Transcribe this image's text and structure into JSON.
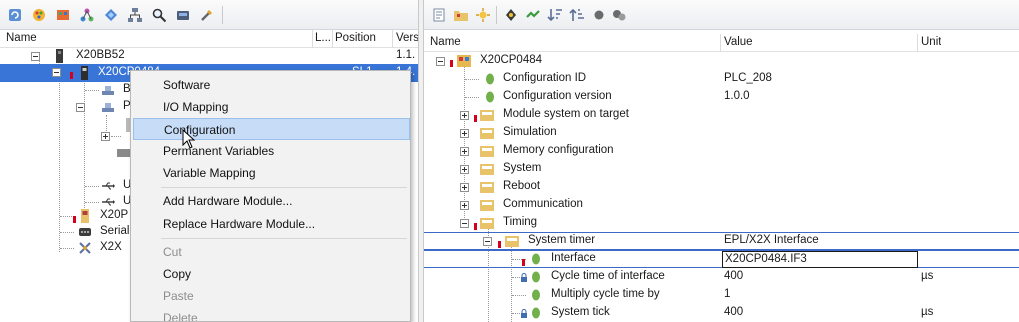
{
  "left_pane": {
    "toolbar_icons": [
      "refresh-icon",
      "palette-icon",
      "module-icon",
      "network-icon",
      "diamond-icon",
      "hierarchy-icon",
      "find-icon",
      "device-icon",
      "tools-icon"
    ],
    "columns": {
      "name": "Name",
      "l": "L...",
      "position": "Position",
      "version": "Vers"
    },
    "tree": [
      {
        "label": "X20BB52",
        "version": "1.1."
      },
      {
        "label": "X20CP0484",
        "position": "SL1",
        "version": "1.4."
      },
      {
        "label": "B"
      },
      {
        "label": "P"
      },
      {
        "label": "U"
      },
      {
        "label": "U"
      },
      {
        "label": "X20P"
      },
      {
        "label": "Serial"
      },
      {
        "label": "X2X"
      }
    ]
  },
  "context_menu": {
    "items": [
      {
        "label": "Software",
        "enabled": true
      },
      {
        "label": "I/O Mapping",
        "enabled": true
      },
      {
        "label": "Configuration",
        "enabled": true,
        "hovered": true
      },
      {
        "label": "Permanent Variables",
        "enabled": true
      },
      {
        "label": "Variable Mapping",
        "enabled": true
      },
      {
        "label": "Add Hardware Module...",
        "enabled": true
      },
      {
        "label": "Replace Hardware Module...",
        "enabled": true
      },
      {
        "label": "Cut",
        "enabled": false
      },
      {
        "label": "Copy",
        "enabled": true
      },
      {
        "label": "Paste",
        "enabled": false
      },
      {
        "label": "Delete",
        "enabled": false
      }
    ]
  },
  "right_pane": {
    "toolbar_icons": [
      "page-icon",
      "folder-icon",
      "sun-icon",
      "settings-icon",
      "expand-icon",
      "sort-desc-icon",
      "sort-asc-icon",
      "circle-icon",
      "circles-icon"
    ],
    "columns": {
      "name": "Name",
      "value": "Value",
      "unit": "Unit"
    },
    "rows": [
      {
        "name": "X20CP0484",
        "value": "",
        "unit": ""
      },
      {
        "name": "Configuration ID",
        "value": "PLC_208",
        "unit": ""
      },
      {
        "name": "Configuration version",
        "value": "1.0.0",
        "unit": ""
      },
      {
        "name": "Module system on target",
        "value": "",
        "unit": ""
      },
      {
        "name": "Simulation",
        "value": "",
        "unit": ""
      },
      {
        "name": "Memory configuration",
        "value": "",
        "unit": ""
      },
      {
        "name": "System",
        "value": "",
        "unit": ""
      },
      {
        "name": "Reboot",
        "value": "",
        "unit": ""
      },
      {
        "name": "Communication",
        "value": "",
        "unit": ""
      },
      {
        "name": "Timing",
        "value": "",
        "unit": ""
      },
      {
        "name": "System timer",
        "value": "EPL/X2X Interface",
        "unit": ""
      },
      {
        "name": "Interface",
        "value": "X20CP0484.IF3",
        "unit": ""
      },
      {
        "name": "Cycle time of interface",
        "value": "400",
        "unit": "µs"
      },
      {
        "name": "Multiply cycle time by",
        "value": "1",
        "unit": ""
      },
      {
        "name": "System tick",
        "value": "400",
        "unit": "µs"
      }
    ]
  },
  "colors": {
    "selection": "#3875d7",
    "menu_hover": "#c7dcf7",
    "row_outline": "#3b6bc7",
    "error_mark": "#d6001c"
  }
}
